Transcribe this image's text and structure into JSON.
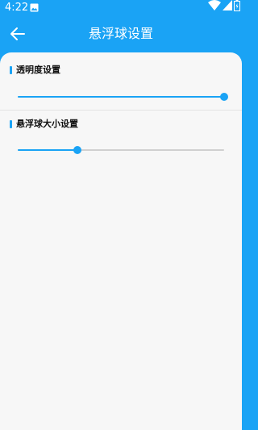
{
  "status_bar": {
    "time": "4:22",
    "icons": [
      "gallery-icon",
      "wifi-icon",
      "signal-icon",
      "battery-icon"
    ]
  },
  "app_bar": {
    "back_icon": "arrow-left-icon",
    "title": "悬浮球设置"
  },
  "settings": {
    "opacity": {
      "label": "透明度设置",
      "value_fraction": 1.0
    },
    "size": {
      "label": "悬浮球大小设置",
      "value_fraction": 0.29
    }
  },
  "colors": {
    "primary": "#1aa3f5",
    "background": "#f7f7f7",
    "track": "#d0d0d0"
  }
}
